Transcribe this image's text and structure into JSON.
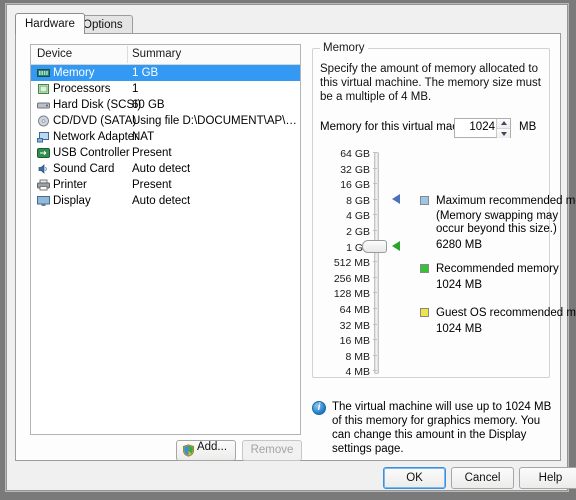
{
  "dialog": {
    "tabs": [
      {
        "label": "Hardware",
        "active": true
      },
      {
        "label": "Options",
        "active": false
      }
    ]
  },
  "device_list": {
    "columns": [
      "Device",
      "Summary"
    ],
    "rows": [
      {
        "icon": "memory-icon",
        "device": "Memory",
        "summary": "1 GB",
        "selected": true
      },
      {
        "icon": "processor-icon",
        "device": "Processors",
        "summary": "1",
        "selected": false
      },
      {
        "icon": "harddisk-icon",
        "device": "Hard Disk (SCSI)",
        "summary": "60 GB",
        "selected": false
      },
      {
        "icon": "cddvd-icon",
        "device": "CD/DVD (SATA)",
        "summary": "Using file D:\\DOCUMENT\\AP\\Hiren\\Hi...",
        "selected": false
      },
      {
        "icon": "network-icon",
        "device": "Network Adapter",
        "summary": "NAT",
        "selected": false
      },
      {
        "icon": "usb-icon",
        "device": "USB Controller",
        "summary": "Present",
        "selected": false
      },
      {
        "icon": "soundcard-icon",
        "device": "Sound Card",
        "summary": "Auto detect",
        "selected": false
      },
      {
        "icon": "printer-icon",
        "device": "Printer",
        "summary": "Present",
        "selected": false
      },
      {
        "icon": "display-icon",
        "device": "Display",
        "summary": "Auto detect",
        "selected": false
      }
    ],
    "add_label": "Add...",
    "remove_label": "Remove"
  },
  "memory_panel": {
    "group_title": "Memory",
    "description": "Specify the amount of memory allocated to this virtual machine. The memory size must be a multiple of 4 MB.",
    "field_label": "Memory for this virtual machine:",
    "value": "1024",
    "unit": "MB",
    "scale_labels": [
      "64 GB",
      "32 GB",
      "16 GB",
      "8 GB",
      "4 GB",
      "2 GB",
      "1 GB",
      "512 MB",
      "256 MB",
      "128 MB",
      "64 MB",
      "32 MB",
      "16 MB",
      "8 MB",
      "4 MB"
    ],
    "slider_at_label": "1 GB",
    "markers": [
      {
        "name": "maximum-recommended-marker",
        "color": "#4a72b8",
        "at_label": "8 GB"
      },
      {
        "name": "current-value-marker",
        "color": "#29a329",
        "at_label": "1 GB"
      }
    ],
    "legend": [
      {
        "swatch_color": "#9ec4e8",
        "title": "Maximum recommended memory",
        "note": "(Memory swapping may\noccur beyond this size.)",
        "value": "6280 MB"
      },
      {
        "swatch_color": "#35c235",
        "title": "Recommended memory",
        "note": "",
        "value": "1024 MB"
      },
      {
        "swatch_color": "#f2e34a",
        "title": "Guest OS recommended minimum",
        "note": "",
        "value": "1024 MB"
      }
    ],
    "info_icon": "info-icon",
    "info_text": "The virtual machine will use up to 1024 MB of this memory for graphics memory. You can change this amount in the Display settings page."
  },
  "footer": {
    "ok_label": "OK",
    "cancel_label": "Cancel",
    "help_label": "Help"
  },
  "colors": {
    "selection": "#3399f3",
    "dialog_bg": "#f0f0f0",
    "panel_bg": "#fdfdfd"
  }
}
